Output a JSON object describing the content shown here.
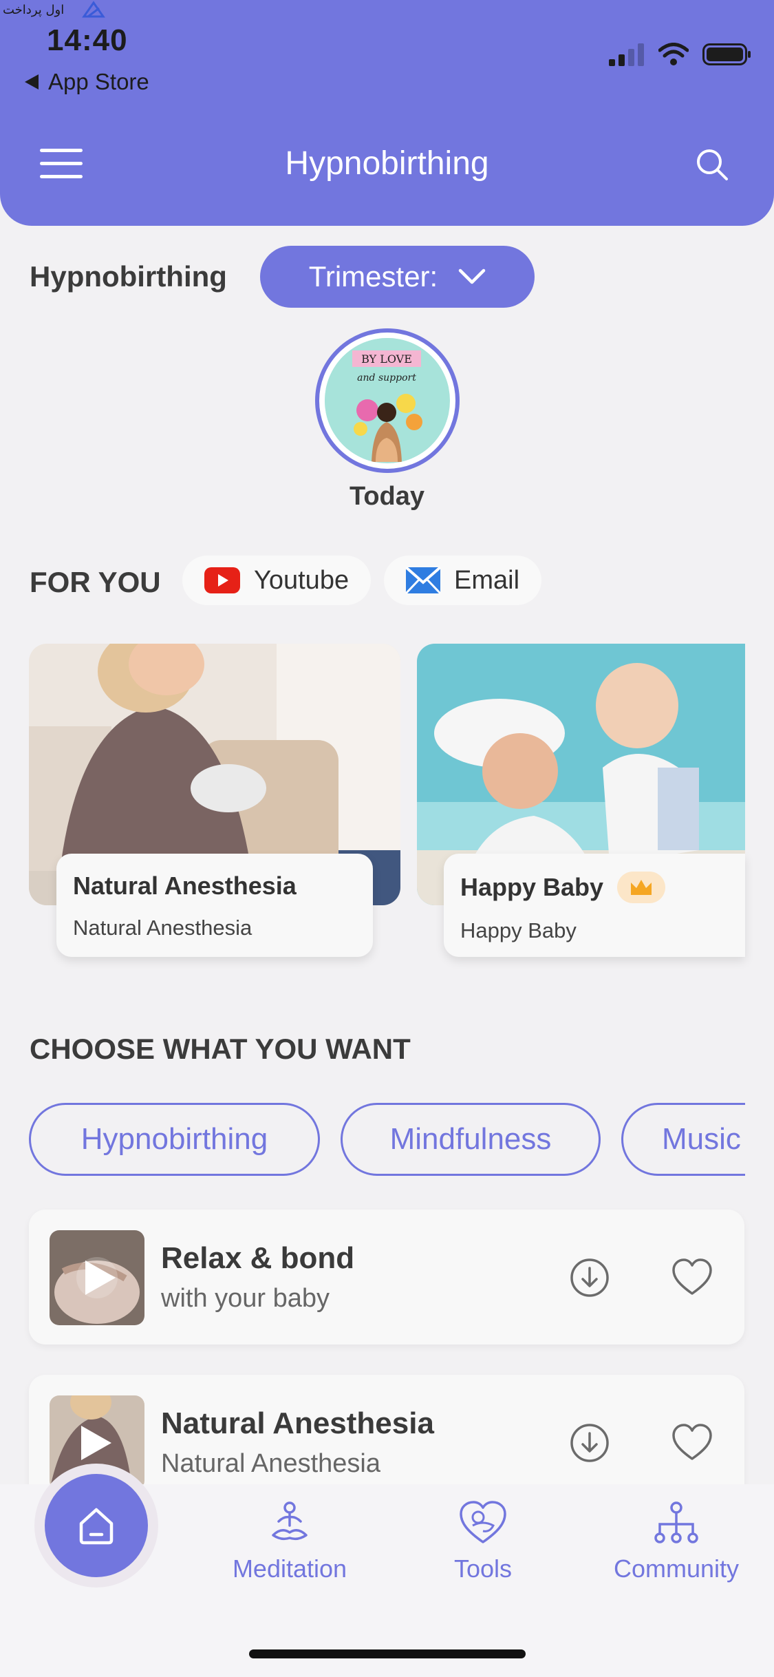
{
  "status_bar": {
    "time": "14:40",
    "back_label": "App Store",
    "watermark_text": "اول پرداخت"
  },
  "header": {
    "title": "Hypnobirthing",
    "menu_icon": "hamburger-menu-icon",
    "search_icon": "search-icon"
  },
  "filter": {
    "label": "Hypnobirthing",
    "trimester_label": "Trimester:"
  },
  "today": {
    "label": "Today",
    "image_text_1": "BY LOVE",
    "image_text_2": "and support"
  },
  "for_you": {
    "label": "FOR YOU",
    "pills": [
      {
        "label": "Youtube",
        "icon": "youtube-icon"
      },
      {
        "label": "Email",
        "icon": "email-icon"
      }
    ],
    "cards": [
      {
        "title": "Natural Anesthesia",
        "subtitle": "Natural Anesthesia"
      },
      {
        "title": "Happy Baby",
        "subtitle": "Happy Baby",
        "premium_icon": "crown-icon"
      }
    ]
  },
  "choose": {
    "label": "CHOOSE WHAT YOU WANT",
    "categories": [
      "Hypnobirthing",
      "Mindfulness",
      "Music"
    ]
  },
  "tracks": [
    {
      "title": "Relax & bond",
      "subtitle": "with your baby"
    },
    {
      "title": "Natural Anesthesia",
      "subtitle": "Natural Anesthesia"
    }
  ],
  "bottom_nav": {
    "items": [
      {
        "label": "Meditation",
        "icon": "meditation-icon"
      },
      {
        "label": "Tools",
        "icon": "baby-heart-icon"
      },
      {
        "label": "Community",
        "icon": "community-icon"
      }
    ],
    "home_icon": "home-icon"
  },
  "colors": {
    "primary": "#7276DE",
    "background": "#F2F1F3",
    "crown_bg": "#FCE6C8"
  }
}
